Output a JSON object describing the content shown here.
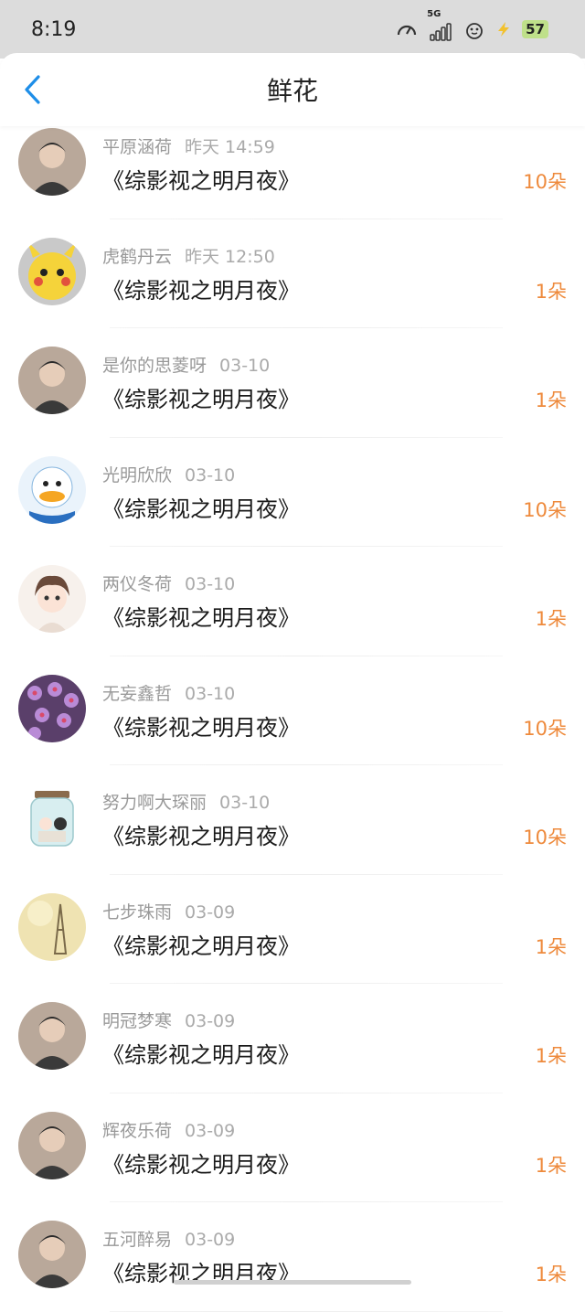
{
  "status": {
    "time": "8:19",
    "network": "5G",
    "battery": "57",
    "icons": [
      "speed-icon",
      "signal-icon",
      "alarm-icon",
      "wifi-icon",
      "charging-icon",
      "battery-icon"
    ]
  },
  "header": {
    "title": "鲜花",
    "back_icon": "back-chevron-icon"
  },
  "colors": {
    "accent": "#1e8ee8",
    "count": "#ee8a3c",
    "meta_text": "#999999",
    "status_bar": "#dcdcdc"
  },
  "gifts": [
    {
      "user": "平原涵荷",
      "time": "昨天 14:59",
      "work": "《综影视之明月夜》",
      "count": "10朵",
      "avatar": "avatar-photo"
    },
    {
      "user": "虎鹤丹云",
      "time": "昨天 12:50",
      "work": "《综影视之明月夜》",
      "count": "1朵",
      "avatar": "avatar-pikachu"
    },
    {
      "user": "是你的思菱呀",
      "time": "03-10",
      "work": "《综影视之明月夜》",
      "count": "1朵",
      "avatar": "avatar-photo"
    },
    {
      "user": "光明欣欣",
      "time": "03-10",
      "work": "《综影视之明月夜》",
      "count": "10朵",
      "avatar": "avatar-duck"
    },
    {
      "user": "两仪冬荷",
      "time": "03-10",
      "work": "《综影视之明月夜》",
      "count": "1朵",
      "avatar": "avatar-illustration"
    },
    {
      "user": "无妄鑫哲",
      "time": "03-10",
      "work": "《综影视之明月夜》",
      "count": "10朵",
      "avatar": "avatar-flowers"
    },
    {
      "user": "努力啊大琛丽",
      "time": "03-10",
      "work": "《综影视之明月夜》",
      "count": "10朵",
      "avatar": "avatar-jar"
    },
    {
      "user": "七步珠雨",
      "time": "03-09",
      "work": "《综影视之明月夜》",
      "count": "1朵",
      "avatar": "avatar-eiffel"
    },
    {
      "user": "明冠梦寒",
      "time": "03-09",
      "work": "《综影视之明月夜》",
      "count": "1朵",
      "avatar": "avatar-photo"
    },
    {
      "user": "辉夜乐荷",
      "time": "03-09",
      "work": "《综影视之明月夜》",
      "count": "1朵",
      "avatar": "avatar-photo"
    },
    {
      "user": "五河醉易",
      "time": "03-09",
      "work": "《综影视之明月夜》",
      "count": "1朵",
      "avatar": "avatar-photo"
    }
  ]
}
